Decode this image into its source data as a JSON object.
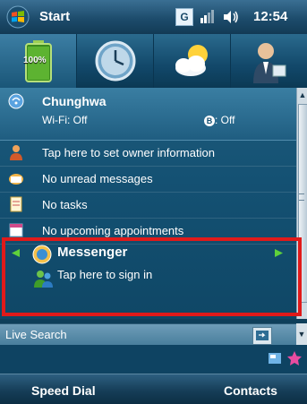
{
  "titlebar": {
    "start_label": "Start",
    "time": "12:54",
    "network_icon": "G"
  },
  "battery": {
    "percent_label": "100%"
  },
  "today": {
    "carrier": {
      "name": "Chunghwa",
      "wifi": "Wi-Fi: Off",
      "bluetooth": ": Off"
    },
    "owner": "Tap here to set owner information",
    "messages": "No unread messages",
    "tasks": "No tasks",
    "appointments": "No upcoming appointments"
  },
  "messenger": {
    "title": "Messenger",
    "subtitle": "Tap here to sign in"
  },
  "search": {
    "label": "Live Search"
  },
  "softkeys": {
    "left": "Speed Dial",
    "right": "Contacts"
  },
  "colors": {
    "highlight_border": "#e01a1a",
    "accent": "#145173"
  }
}
